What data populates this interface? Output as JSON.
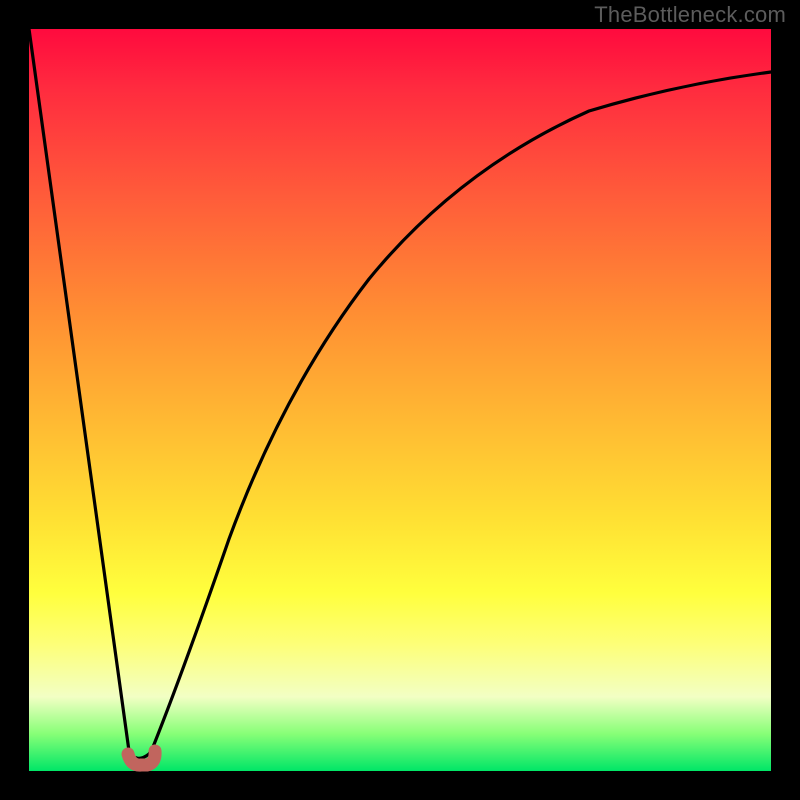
{
  "watermark": "TheBottleneck.com",
  "chart_data": {
    "type": "line",
    "title": "",
    "xlabel": "",
    "ylabel": "",
    "xlim": [
      0,
      100
    ],
    "ylim": [
      0,
      100
    ],
    "grid": false,
    "legend": false,
    "x": [
      0,
      1,
      2,
      3,
      4,
      5,
      6,
      7,
      8,
      9,
      10,
      11,
      12,
      13,
      14,
      16,
      18,
      20,
      22,
      24,
      26,
      28,
      30,
      33,
      36,
      40,
      45,
      50,
      55,
      60,
      65,
      70,
      75,
      80,
      85,
      90,
      95,
      100
    ],
    "values": [
      100,
      93,
      85,
      78,
      70,
      63,
      55,
      48,
      40,
      33,
      25,
      18,
      10,
      3,
      1,
      1,
      3,
      11,
      20,
      28,
      36,
      42,
      48,
      55,
      61,
      67,
      73,
      78,
      81,
      84,
      86,
      88,
      90,
      91,
      92,
      93,
      94,
      94
    ],
    "gradient": {
      "top_color": "#ff0a3e",
      "mid_color": "#ffe033",
      "bottom_color": "#00e667"
    },
    "marker": {
      "color": "#c1655e",
      "x_range": [
        13,
        16
      ],
      "y": 1
    }
  }
}
